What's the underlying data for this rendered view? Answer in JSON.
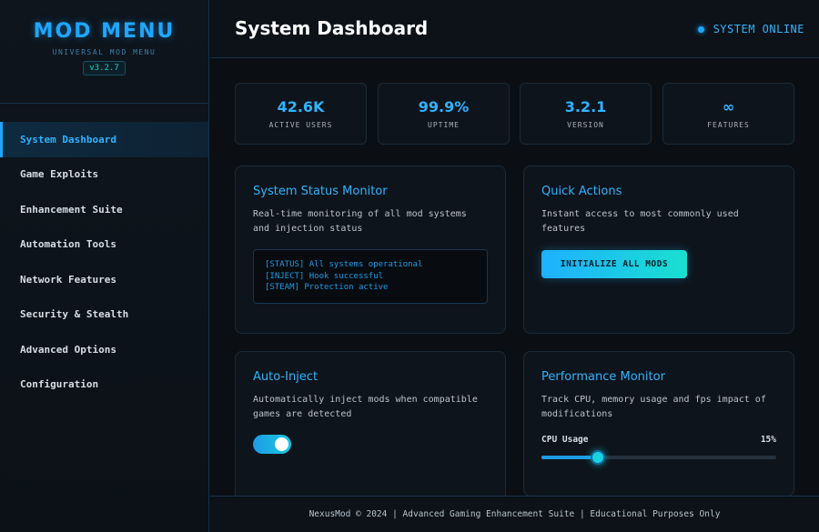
{
  "brand": {
    "title": "MOD MENU",
    "subtitle": "UNIVERSAL MOD MENU",
    "version": "v3.2.7"
  },
  "sidebar": {
    "items": [
      {
        "label": "System Dashboard",
        "active": true
      },
      {
        "label": "Game Exploits"
      },
      {
        "label": "Enhancement Suite"
      },
      {
        "label": "Automation Tools"
      },
      {
        "label": "Network Features"
      },
      {
        "label": "Security & Stealth"
      },
      {
        "label": "Advanced Options"
      },
      {
        "label": "Configuration"
      }
    ]
  },
  "header": {
    "title": "System Dashboard",
    "status": "SYSTEM ONLINE"
  },
  "stats": [
    {
      "value": "42.6K",
      "label": "ACTIVE USERS"
    },
    {
      "value": "99.9%",
      "label": "UPTIME"
    },
    {
      "value": "3.2.1",
      "label": "VERSION"
    },
    {
      "value": "∞",
      "label": "FEATURES"
    }
  ],
  "cards": {
    "status_monitor": {
      "title": "System Status Monitor",
      "desc": "Real-time monitoring of all mod systems and injection status",
      "console": [
        "[STATUS] All systems operational",
        "[INJECT] Hook successful",
        "[STEAM] Protection active"
      ]
    },
    "quick_actions": {
      "title": "Quick Actions",
      "desc": "Instant access to most commonly used features",
      "button": "INITIALIZE ALL MODS"
    },
    "auto_inject": {
      "title": "Auto-Inject",
      "desc": "Automatically inject mods when compatible games are detected",
      "enabled": true
    },
    "performance": {
      "title": "Performance Monitor",
      "desc": "Track CPU, memory usage and fps impact of modifications",
      "metric_label": "CPU Usage",
      "metric_value": "15%",
      "level": 0.24
    }
  },
  "footer": {
    "text": "NexusMod © 2024 | Advanced Gaming Enhancement Suite | Educational Purposes Only"
  },
  "colors": {
    "accent": "#1ea7ff",
    "accent_teal": "#19d3c5",
    "background": "#0b0f14"
  }
}
